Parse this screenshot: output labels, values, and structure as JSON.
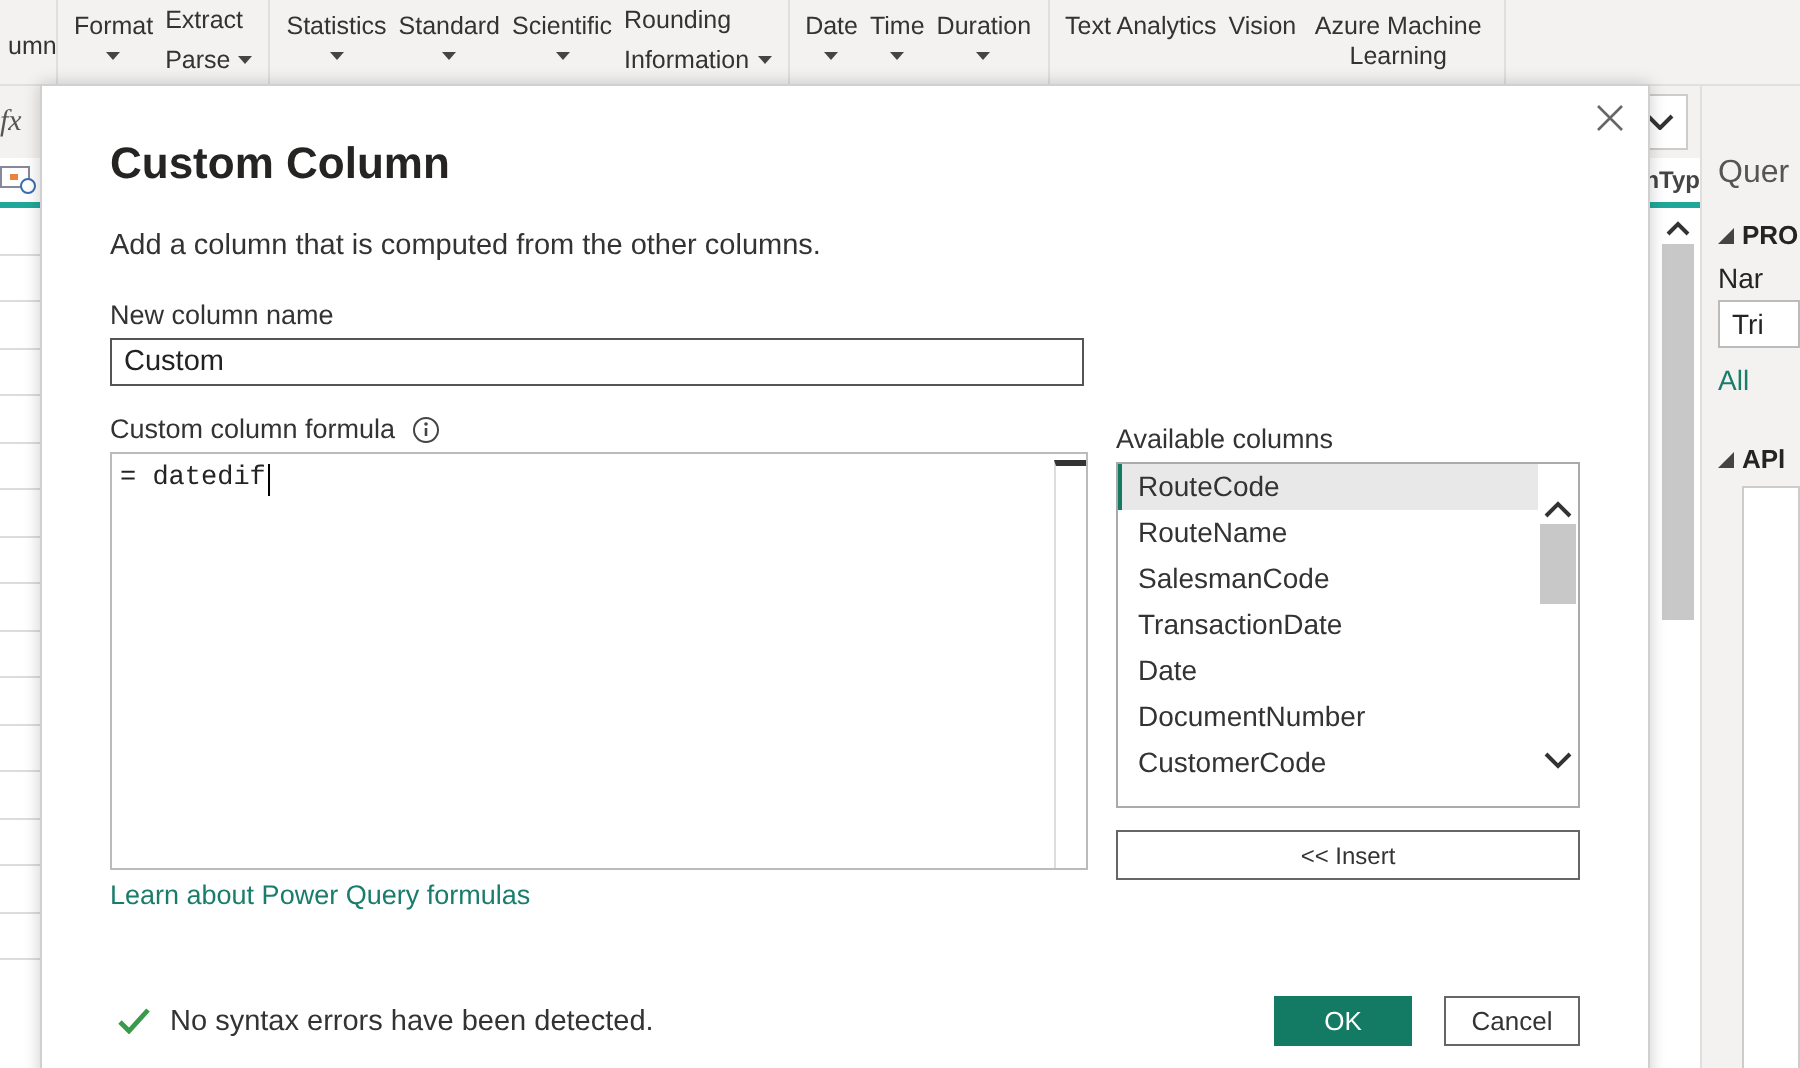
{
  "ribbon": {
    "groups": [
      [
        {
          "items": [
            {
              "label": "umn",
              "dropdown": false
            }
          ]
        }
      ],
      [
        {
          "items": [
            {
              "label": "Format",
              "dropdown": true
            }
          ]
        },
        {
          "items": [
            {
              "label": "Extract",
              "dropdown": false
            },
            {
              "label": "Parse",
              "dropdown": true
            }
          ]
        }
      ],
      [
        {
          "items": [
            {
              "label": "Statistics",
              "dropdown": true
            }
          ]
        },
        {
          "items": [
            {
              "label": "Standard",
              "dropdown": true
            }
          ]
        },
        {
          "items": [
            {
              "label": "Scientific",
              "dropdown": true
            }
          ]
        },
        {
          "items": [
            {
              "label": "Rounding",
              "dropdown": false
            },
            {
              "label": "Information",
              "dropdown": true
            }
          ]
        }
      ],
      [
        {
          "items": [
            {
              "label": "Date",
              "dropdown": true
            }
          ]
        },
        {
          "items": [
            {
              "label": "Time",
              "dropdown": true
            }
          ]
        },
        {
          "items": [
            {
              "label": "Duration",
              "dropdown": true
            }
          ]
        }
      ],
      [
        {
          "items": [
            {
              "label": "Text Analytics",
              "dropdown": false
            }
          ]
        },
        {
          "items": [
            {
              "label": "Vision",
              "dropdown": false
            }
          ]
        },
        {
          "items": [
            {
              "label": "Azure Machine Learning",
              "dropdown": false
            }
          ]
        }
      ]
    ]
  },
  "formula_bar": {
    "fx": "fx"
  },
  "grid": {
    "column_header": "nTyp"
  },
  "query_settings": {
    "title": "Quer",
    "properties_heading": "PRO",
    "name_label": "Nar",
    "name_value": "Tri",
    "all_link": "All",
    "applied_heading": "APl"
  },
  "dialog": {
    "title": "Custom Column",
    "description": "Add a column that is computed from the other columns.",
    "name_label": "New column name",
    "name_value": "Custom",
    "formula_label": "Custom column formula",
    "formula_value": "= datedif",
    "available_label": "Available columns",
    "columns": [
      {
        "name": "RouteCode",
        "selected": true
      },
      {
        "name": "RouteName",
        "selected": false
      },
      {
        "name": "SalesmanCode",
        "selected": false
      },
      {
        "name": "TransactionDate",
        "selected": false
      },
      {
        "name": "Date",
        "selected": false
      },
      {
        "name": "DocumentNumber",
        "selected": false
      },
      {
        "name": "CustomerCode",
        "selected": false
      }
    ],
    "insert_button": "<< Insert",
    "learn_link": "Learn about Power Query formulas",
    "status": {
      "valid": true,
      "message": "No syntax errors have been detected."
    },
    "ok_button": "OK",
    "cancel_button": "Cancel"
  }
}
